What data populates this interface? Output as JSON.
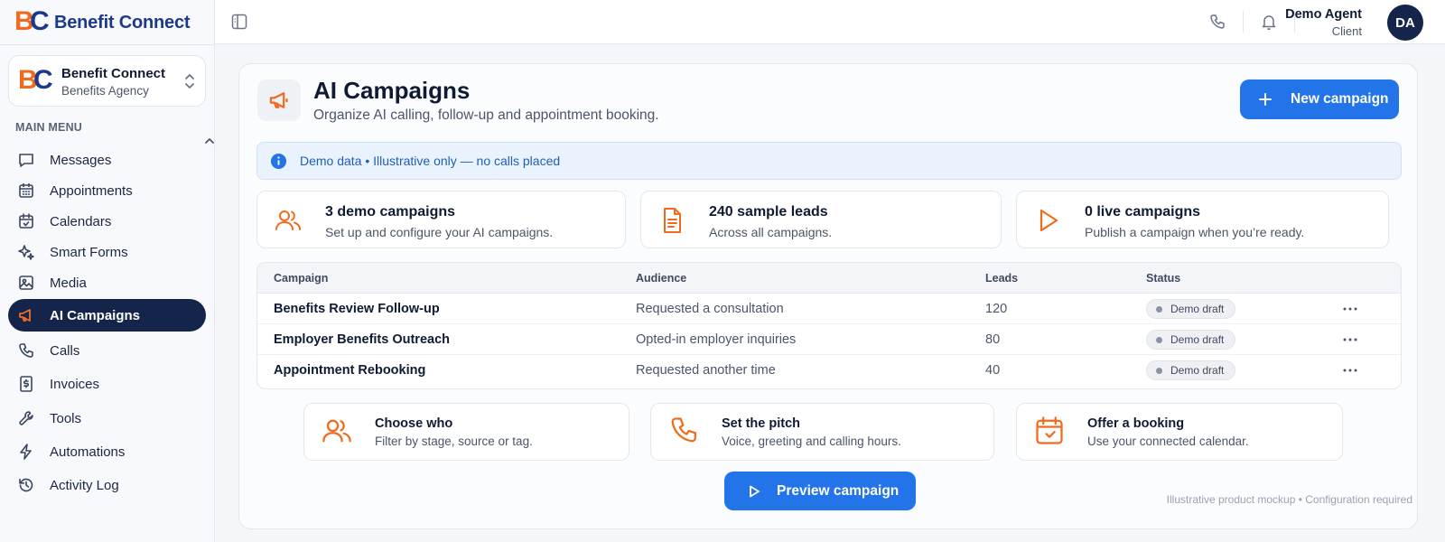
{
  "brand": {
    "name": "Benefit Connect",
    "logo_b": "B",
    "logo_c": "C"
  },
  "account": {
    "name": "Benefit Connect",
    "subtitle": "Benefits Agency"
  },
  "sidebar": {
    "section_label": "MAIN MENU",
    "items": [
      {
        "label": "Messages",
        "icon": "message-icon",
        "active": false
      },
      {
        "label": "Appointments",
        "icon": "calendar-grid-icon",
        "active": false
      },
      {
        "label": "Calendars",
        "icon": "calendar-check-icon",
        "active": false
      },
      {
        "label": "Smart Forms",
        "icon": "sparkle-icon",
        "active": false
      },
      {
        "label": "Media",
        "icon": "image-icon",
        "active": false
      },
      {
        "label": "AI Campaigns",
        "icon": "megaphone-icon",
        "active": true
      },
      {
        "label": "Calls",
        "icon": "phone-icon",
        "active": false
      },
      {
        "label": "Invoices",
        "icon": "invoice-icon",
        "active": false
      },
      {
        "label": "Tools",
        "icon": "wrench-icon",
        "active": false
      },
      {
        "label": "Automations",
        "icon": "lightning-icon",
        "active": false
      },
      {
        "label": "Activity Log",
        "icon": "history-icon",
        "active": false
      }
    ]
  },
  "topbar": {
    "user_name": "Demo Agent",
    "user_role": "Client",
    "avatar_initials": "DA"
  },
  "page": {
    "title": "AI Campaigns",
    "subtitle": "Organize AI calling, follow-up and appointment booking.",
    "new_button": "New campaign",
    "banner": "Demo data • Illustrative only — no calls placed"
  },
  "stats": [
    {
      "title": "3 demo campaigns",
      "subtitle": "Set up and configure your AI campaigns.",
      "icon": "users-icon"
    },
    {
      "title": "240 sample leads",
      "subtitle": "Across all campaigns.",
      "icon": "document-icon"
    },
    {
      "title": "0 live campaigns",
      "subtitle": "Publish a campaign when you’re ready.",
      "icon": "play-icon"
    }
  ],
  "table": {
    "columns": [
      "Campaign",
      "Audience",
      "Leads",
      "Status"
    ],
    "rows": [
      {
        "campaign": "Benefits Review Follow-up",
        "audience": "Requested a consultation",
        "leads": "120",
        "status": "Demo draft"
      },
      {
        "campaign": "Employer Benefits Outreach",
        "audience": "Opted-in employer inquiries",
        "leads": "80",
        "status": "Demo draft"
      },
      {
        "campaign": "Appointment Rebooking",
        "audience": "Requested another time",
        "leads": "40",
        "status": "Demo draft"
      }
    ]
  },
  "steps": [
    {
      "title": "Choose who",
      "subtitle": "Filter by stage, source or tag.",
      "icon": "users-icon"
    },
    {
      "title": "Set the pitch",
      "subtitle": "Voice, greeting and calling hours.",
      "icon": "phone-icon"
    },
    {
      "title": "Offer a booking",
      "subtitle": "Use your connected calendar.",
      "icon": "calendar-icon"
    }
  ],
  "preview_button": "Preview campaign",
  "footnote": "Illustrative product mockup • Configuration required",
  "colors": {
    "accent": "#2274e8",
    "brand_orange": "#f26b1d",
    "navy": "#15244a",
    "brand_blue": "#1d3a8a"
  }
}
